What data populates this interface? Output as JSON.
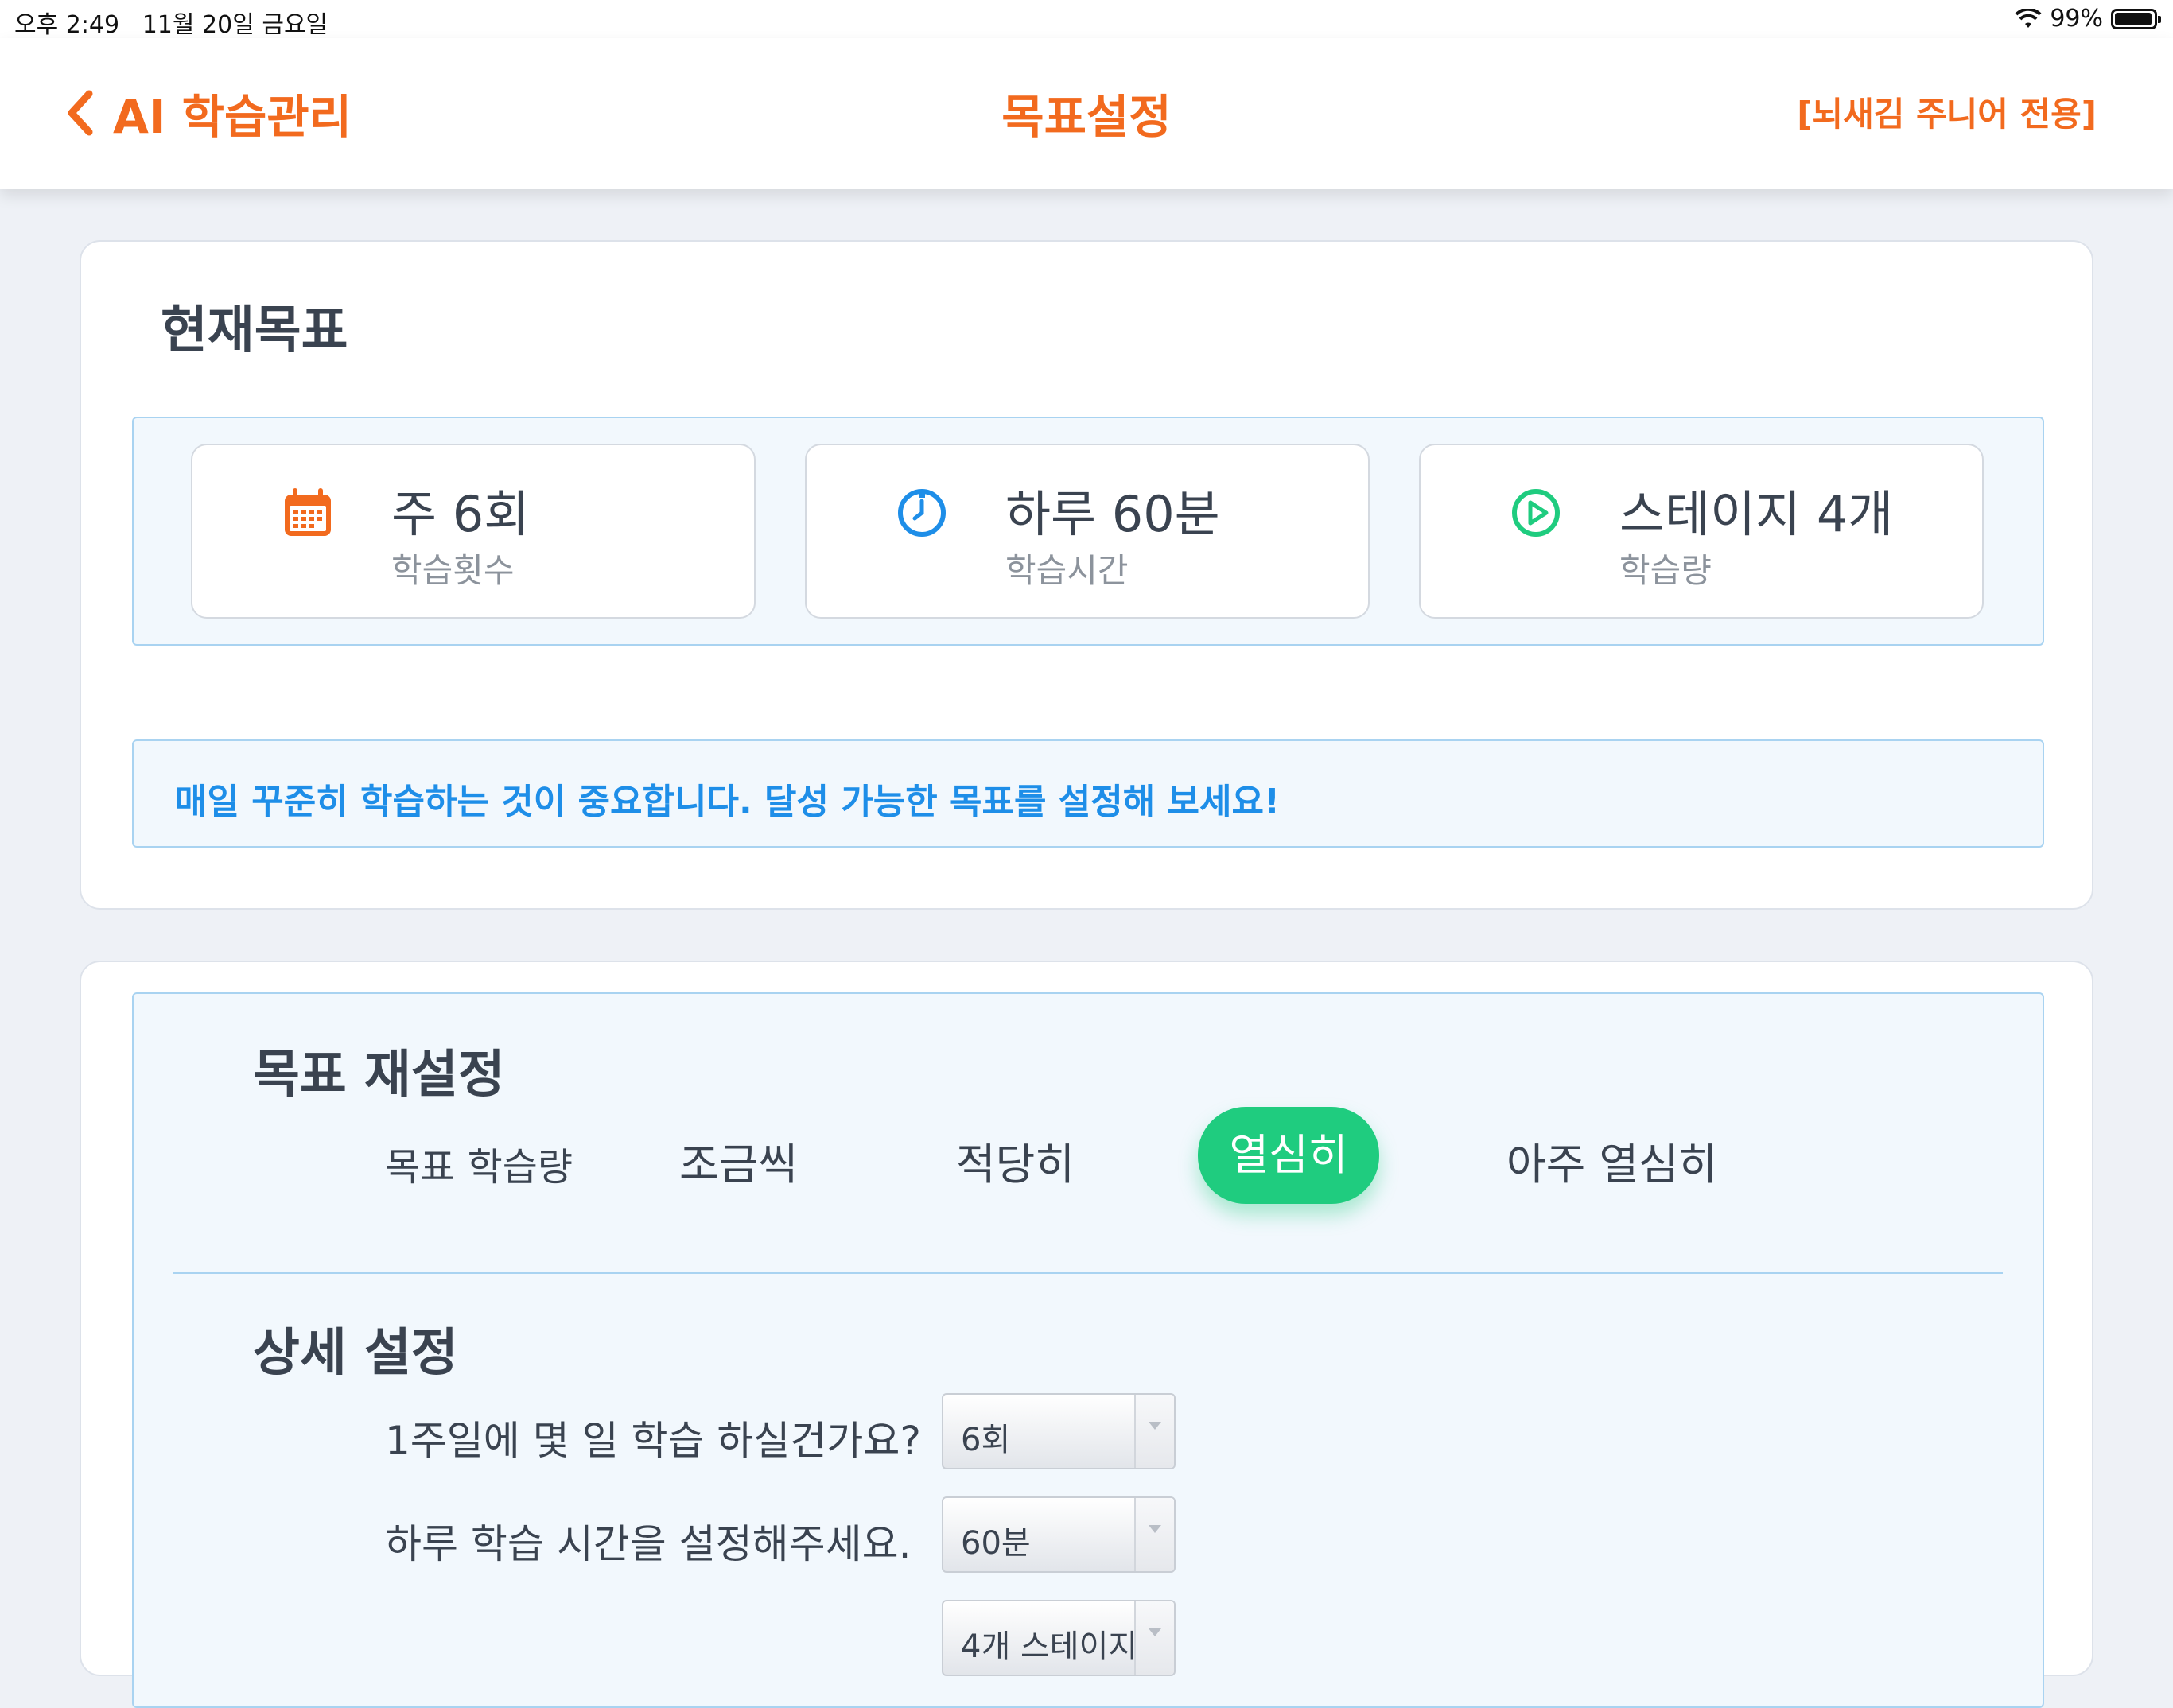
{
  "status_bar": {
    "time": "오후 2:49",
    "date": "11월 20일 금요일",
    "battery": "99%"
  },
  "nav": {
    "back_label": "AI 학습관리",
    "title": "목표설정",
    "right_label": "[뇌새김 주니어 전용]"
  },
  "current_goal": {
    "heading": "현재목표",
    "items": [
      {
        "icon": "calendar-icon",
        "value": "주 6회",
        "label": "학습횟수"
      },
      {
        "icon": "clock-icon",
        "value": "하루 60분",
        "label": "학습시간"
      },
      {
        "icon": "play-circle-icon",
        "value": "스테이지 4개",
        "label": "학습량"
      }
    ],
    "notice": "매일 꾸준히 학습하는 것이 중요합니다. 달성 가능한 목표를 설정해 보세요!"
  },
  "reset": {
    "heading": "목표 재설정",
    "level_label": "목표 학습량",
    "levels": [
      "조금씩",
      "적당히",
      "열심히",
      "아주 열심히"
    ],
    "selected_level": "열심히"
  },
  "detail": {
    "heading": "상세 설정",
    "questions": [
      {
        "label": "1주일에 몇 일 학습 하실건가요?",
        "value": "6회"
      },
      {
        "label": "하루 학습 시간을 설정해주세요.",
        "value": "60분"
      },
      {
        "label": "",
        "value": "4개 스테이지"
      }
    ]
  },
  "colors": {
    "accent_orange": "#f26a1e",
    "accent_blue": "#1e8ee8",
    "accent_green": "#1fcc7f"
  }
}
